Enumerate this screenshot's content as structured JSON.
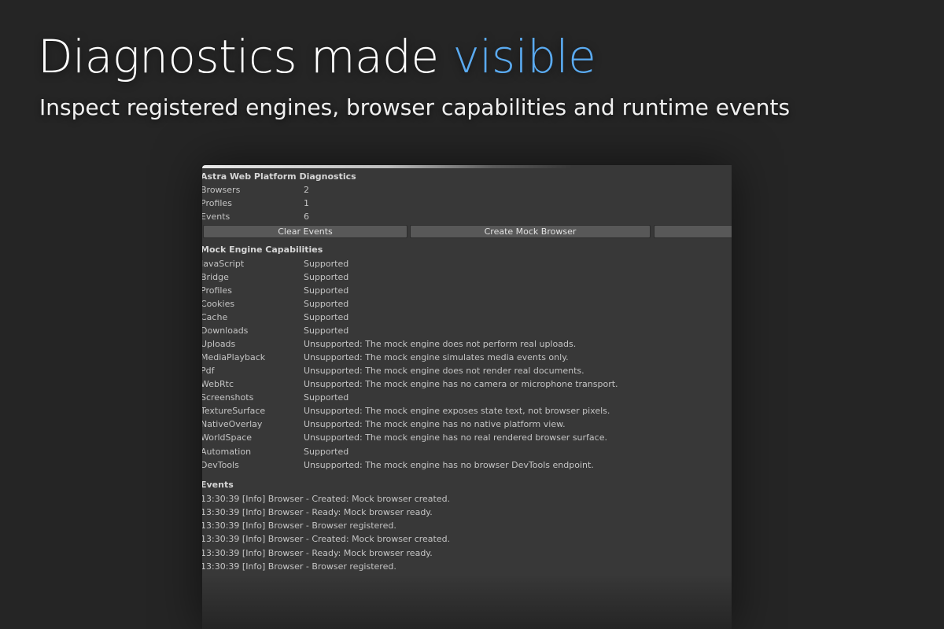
{
  "hero": {
    "title_main": "Diagnostics made ",
    "title_accent": "visible",
    "subtitle": "Inspect registered engines, browser capabilities and runtime events"
  },
  "panel": {
    "title": "Astra Web Platform Diagnostics",
    "stats": [
      {
        "label": "Browsers",
        "value": "2"
      },
      {
        "label": "Profiles",
        "value": "1"
      },
      {
        "label": "Events",
        "value": "6"
      }
    ],
    "buttons": {
      "clear_events": "Clear Events",
      "create_mock_browser": "Create Mock Browser",
      "third": ""
    },
    "capabilities_title": "Mock Engine Capabilities",
    "capabilities": [
      {
        "name": "JavaScript",
        "status": "Supported"
      },
      {
        "name": "Bridge",
        "status": "Supported"
      },
      {
        "name": "Profiles",
        "status": "Supported"
      },
      {
        "name": "Cookies",
        "status": "Supported"
      },
      {
        "name": "Cache",
        "status": "Supported"
      },
      {
        "name": "Downloads",
        "status": "Supported"
      },
      {
        "name": "Uploads",
        "status": "Unsupported: The mock engine does not perform real uploads."
      },
      {
        "name": "MediaPlayback",
        "status": "Unsupported: The mock engine simulates media events only."
      },
      {
        "name": "Pdf",
        "status": "Unsupported: The mock engine does not render real documents."
      },
      {
        "name": "WebRtc",
        "status": "Unsupported: The mock engine has no camera or microphone transport."
      },
      {
        "name": "Screenshots",
        "status": "Supported"
      },
      {
        "name": "TextureSurface",
        "status": "Unsupported: The mock engine exposes state text, not browser pixels."
      },
      {
        "name": "NativeOverlay",
        "status": "Unsupported: The mock engine has no native platform view."
      },
      {
        "name": "WorldSpace",
        "status": "Unsupported: The mock engine has no real rendered browser surface."
      },
      {
        "name": "Automation",
        "status": "Supported"
      },
      {
        "name": "DevTools",
        "status": "Unsupported: The mock engine has no browser DevTools endpoint."
      }
    ],
    "events_title": "Events",
    "events": [
      "13:30:39 [Info] Browser - Created: Mock browser created.",
      "13:30:39 [Info] Browser - Ready: Mock browser ready.",
      "13:30:39 [Info] Browser - Browser registered.",
      "13:30:39 [Info] Browser - Created: Mock browser created.",
      "13:30:39 [Info] Browser - Ready: Mock browser ready.",
      "13:30:39 [Info] Browser - Browser registered."
    ]
  },
  "colors": {
    "background": "#252525",
    "panel": "#383838",
    "accent": "#5aaaf0",
    "button": "#585858"
  }
}
